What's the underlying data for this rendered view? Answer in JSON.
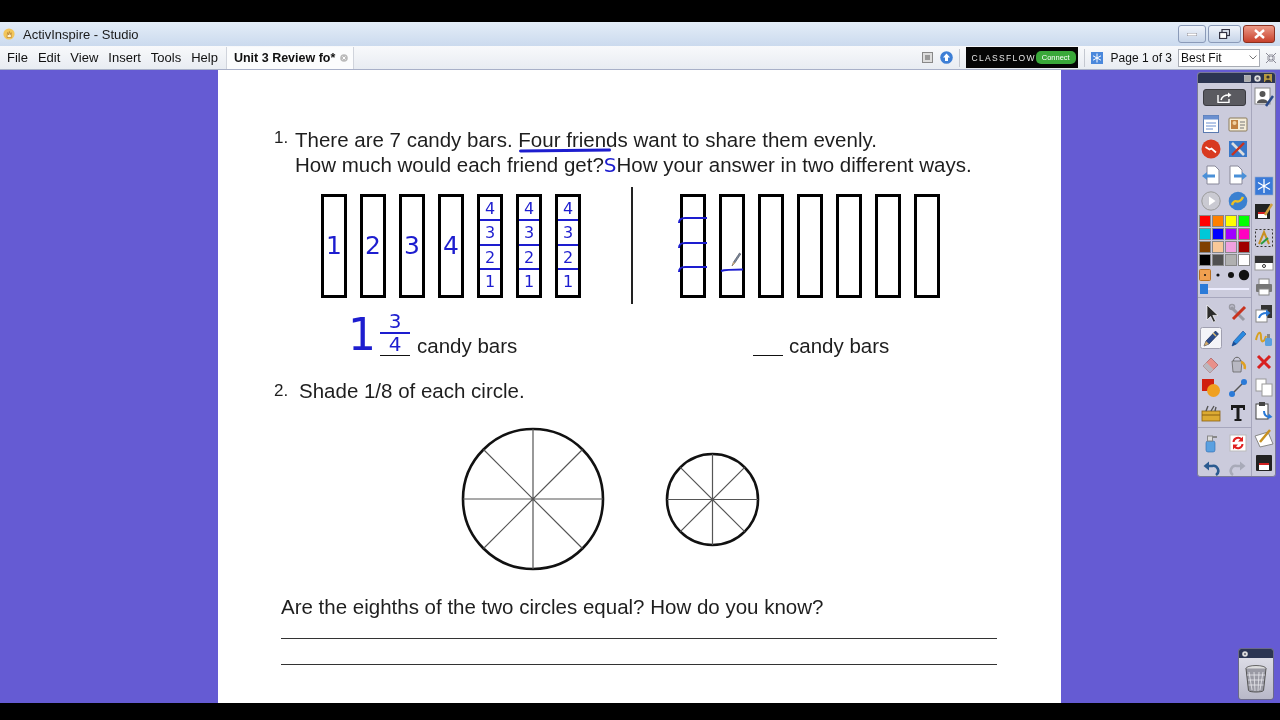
{
  "window": {
    "title": "ActivInspire - Studio"
  },
  "menu_bar": {
    "menus": [
      "File",
      "Edit",
      "View",
      "Insert",
      "Tools",
      "Help"
    ],
    "tabs": [
      {
        "label": "Unit 3 Review fo*",
        "selected": true
      }
    ],
    "classflow": {
      "brand": "CLASSFLOW",
      "button": "Connect"
    },
    "page_indicator": "Page 1 of 3",
    "zoom": {
      "value": "Best Fit"
    }
  },
  "worksheet": {
    "question_1": {
      "number": "1.",
      "lines": [
        [
          {
            "kind": "plain",
            "text": "There are 7 candy bars. "
          },
          {
            "kind": "underlined",
            "text": "Four friends"
          },
          {
            "kind": "plain",
            "text": " want to share them evenly."
          }
        ],
        [
          {
            "kind": "plain",
            "text": "How much would each friend get?"
          },
          {
            "kind": "ink",
            "text": "S"
          },
          {
            "kind": "plain",
            "text": "How your answer in two different ways."
          }
        ]
      ],
      "left_bars": [
        {
          "kind": "whole",
          "labels": [
            "1"
          ]
        },
        {
          "kind": "whole",
          "labels": [
            "2"
          ]
        },
        {
          "kind": "whole",
          "labels": [
            "3"
          ]
        },
        {
          "kind": "whole",
          "labels": [
            "4"
          ]
        },
        {
          "kind": "quartered",
          "labels": [
            "4",
            "3",
            "2",
            "1"
          ]
        },
        {
          "kind": "quartered",
          "labels": [
            "4",
            "3",
            "2",
            "1"
          ]
        },
        {
          "kind": "quartered",
          "labels": [
            "4",
            "3",
            "2",
            "1"
          ]
        }
      ],
      "right_bars": [
        {
          "kind": "ticked"
        },
        {
          "kind": "started"
        },
        {
          "kind": "blank"
        },
        {
          "kind": "blank"
        },
        {
          "kind": "blank"
        },
        {
          "kind": "blank"
        },
        {
          "kind": "blank"
        }
      ],
      "answers": [
        {
          "kind": "mixed",
          "whole": "1",
          "numerator": "3",
          "denominator": "4",
          "unit": "candy bars"
        },
        {
          "kind": "blank",
          "unit": "candy bars"
        }
      ]
    },
    "question_2": {
      "number": "2.",
      "text": "Shade 1/8 of each circle.",
      "circles": [
        {
          "kind": "large"
        },
        {
          "kind": "small"
        }
      ]
    },
    "question_3": {
      "text": "Are the eighths of the two circles equal? How do you know?"
    }
  },
  "toolbox": {
    "palette": [
      {
        "color": "#ff0000"
      },
      {
        "color": "#ff8000"
      },
      {
        "color": "#ffff00"
      },
      {
        "color": "#00ff00"
      },
      {
        "color": "#00c8d8"
      },
      {
        "color": "#0000ff"
      },
      {
        "color": "#a000ff"
      },
      {
        "color": "#ff00c0"
      },
      {
        "color": "#804000"
      },
      {
        "color": "#f8c898"
      },
      {
        "color": "#f0a0e0"
      },
      {
        "color": "#a00000"
      },
      {
        "color": "#000000"
      },
      {
        "color": "#505050"
      },
      {
        "color": "#b0b0b0"
      },
      {
        "color": "#ffffff"
      }
    ],
    "pen_widths": [
      {
        "kind": "tiny",
        "selected": true
      },
      {
        "kind": "small",
        "selected": false
      },
      {
        "kind": "medium",
        "selected": false
      },
      {
        "kind": "large",
        "selected": false
      }
    ],
    "width_slider": {
      "level": 0
    },
    "tools": [
      {
        "kind": "pointer",
        "selected": false
      },
      {
        "kind": "tools_menu",
        "selected": false
      },
      {
        "kind": "pen",
        "selected": true
      },
      {
        "kind": "highlighter",
        "selected": false
      },
      {
        "kind": "eraser",
        "selected": false
      },
      {
        "kind": "fill",
        "selected": false
      },
      {
        "kind": "shape",
        "selected": false
      },
      {
        "kind": "connector",
        "selected": false
      },
      {
        "kind": "resources",
        "selected": false
      },
      {
        "kind": "text",
        "selected": false
      }
    ],
    "history": [
      {
        "kind": "undo",
        "disabled": false
      },
      {
        "kind": "redo",
        "disabled": true
      }
    ]
  }
}
